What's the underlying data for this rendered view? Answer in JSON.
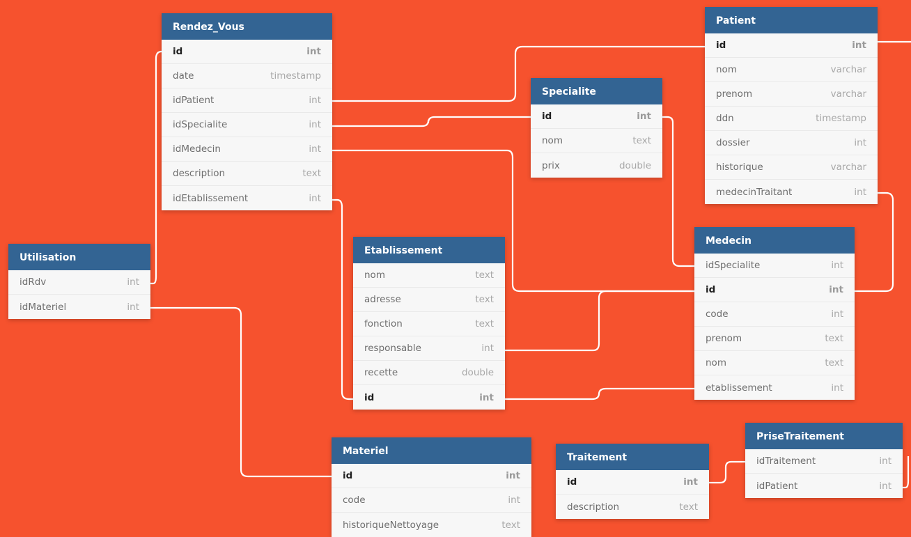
{
  "colors": {
    "background": "#f6522e",
    "header": "#336493",
    "connector": "#ffffff"
  },
  "tables": {
    "rendez_vous": {
      "title": "Rendez_Vous",
      "fields": [
        {
          "name": "id",
          "type": "int",
          "pk": true
        },
        {
          "name": "date",
          "type": "timestamp"
        },
        {
          "name": "idPatient",
          "type": "int"
        },
        {
          "name": "idSpecialite",
          "type": "int"
        },
        {
          "name": "idMedecin",
          "type": "int"
        },
        {
          "name": "description",
          "type": "text"
        },
        {
          "name": "idEtablissement",
          "type": "int"
        }
      ]
    },
    "patient": {
      "title": "Patient",
      "fields": [
        {
          "name": "id",
          "type": "int",
          "pk": true
        },
        {
          "name": "nom",
          "type": "varchar"
        },
        {
          "name": "prenom",
          "type": "varchar"
        },
        {
          "name": "ddn",
          "type": "timestamp"
        },
        {
          "name": "dossier",
          "type": "int"
        },
        {
          "name": "historique",
          "type": "varchar"
        },
        {
          "name": "medecinTraitant",
          "type": "int"
        }
      ]
    },
    "specialite": {
      "title": "Specialite",
      "fields": [
        {
          "name": "id",
          "type": "int",
          "pk": true
        },
        {
          "name": "nom",
          "type": "text"
        },
        {
          "name": "prix",
          "type": "double"
        }
      ]
    },
    "utilisation": {
      "title": "Utilisation",
      "fields": [
        {
          "name": "idRdv",
          "type": "int"
        },
        {
          "name": "idMateriel",
          "type": "int"
        }
      ]
    },
    "etablissement": {
      "title": "Etablissement",
      "fields": [
        {
          "name": "nom",
          "type": "text"
        },
        {
          "name": "adresse",
          "type": "text"
        },
        {
          "name": "fonction",
          "type": "text"
        },
        {
          "name": "responsable",
          "type": "int"
        },
        {
          "name": "recette",
          "type": "double"
        },
        {
          "name": "id",
          "type": "int",
          "pk": true
        }
      ]
    },
    "medecin": {
      "title": "Medecin",
      "fields": [
        {
          "name": "idSpecialite",
          "type": "int"
        },
        {
          "name": "id",
          "type": "int",
          "pk": true
        },
        {
          "name": "code",
          "type": "int"
        },
        {
          "name": "prenom",
          "type": "text"
        },
        {
          "name": "nom",
          "type": "text"
        },
        {
          "name": "etablissement",
          "type": "int"
        }
      ]
    },
    "materiel": {
      "title": "Materiel",
      "fields": [
        {
          "name": "id",
          "type": "int",
          "pk": true
        },
        {
          "name": "code",
          "type": "int"
        },
        {
          "name": "historiqueNettoyage",
          "type": "text"
        }
      ]
    },
    "traitement": {
      "title": "Traitement",
      "fields": [
        {
          "name": "id",
          "type": "int",
          "pk": true
        },
        {
          "name": "description",
          "type": "text"
        }
      ]
    },
    "prise_traitement": {
      "title": "PriseTraitement",
      "fields": [
        {
          "name": "idTraitement",
          "type": "int"
        },
        {
          "name": "idPatient",
          "type": "int"
        }
      ]
    }
  }
}
